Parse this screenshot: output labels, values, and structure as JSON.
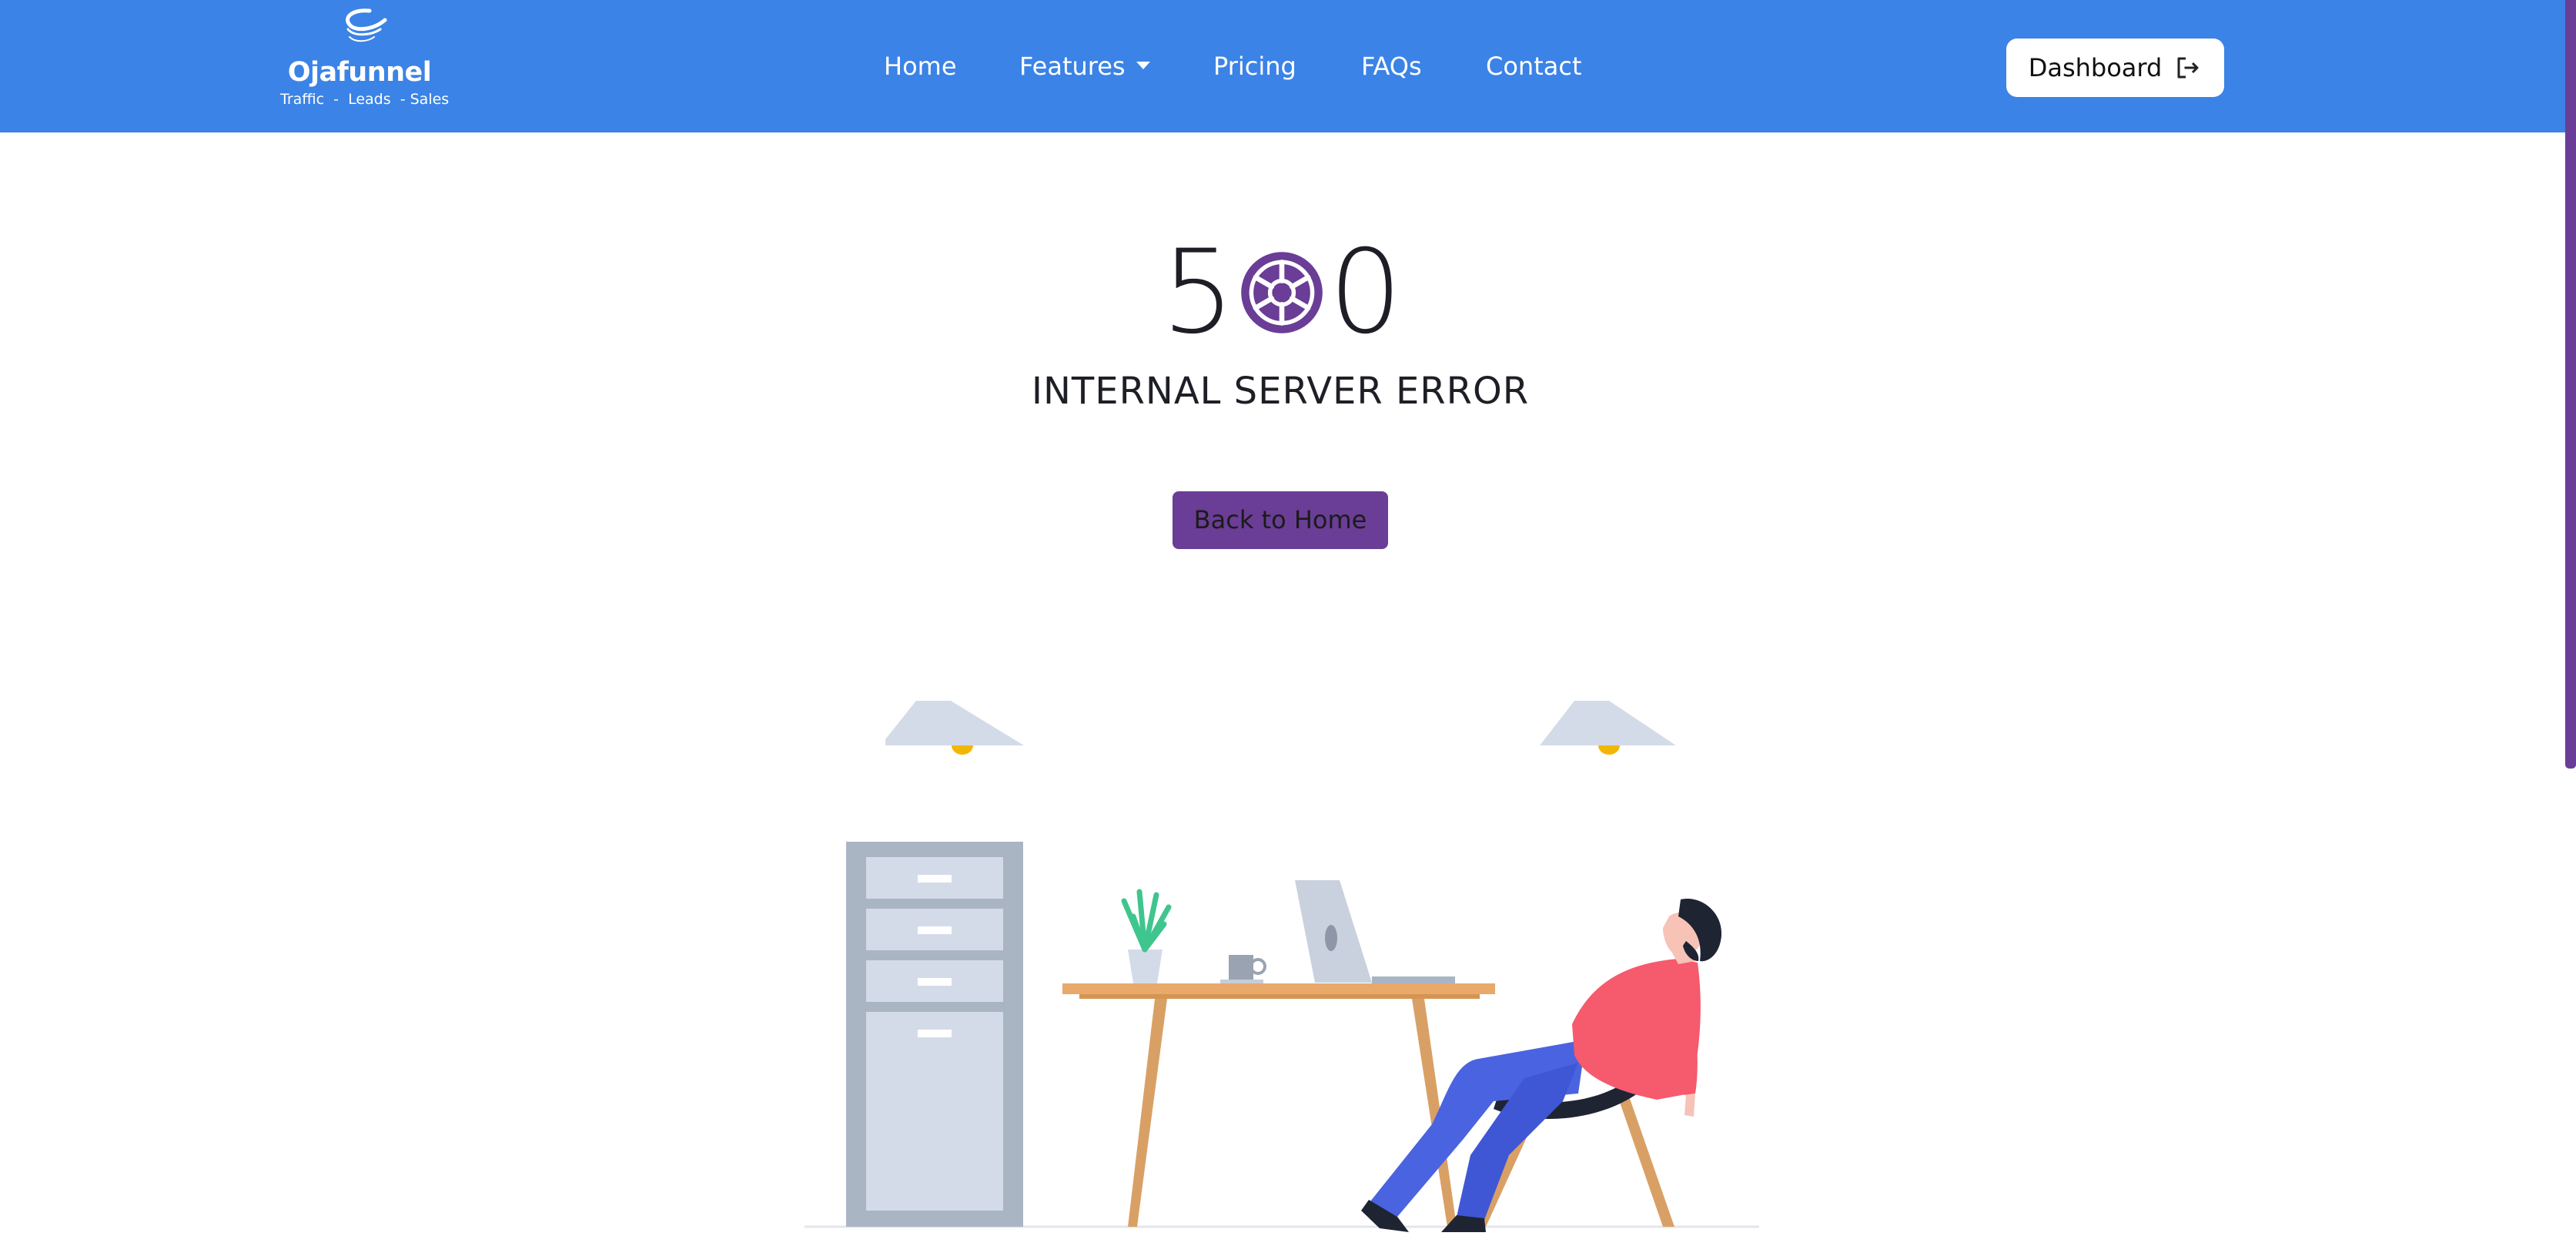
{
  "brand": {
    "name": "Ojafunnel",
    "tagline": "Traffic  -  Leads  - Sales"
  },
  "nav": {
    "items": [
      {
        "label": "Home"
      },
      {
        "label": "Features"
      },
      {
        "label": "Pricing"
      },
      {
        "label": "FAQs"
      },
      {
        "label": "Contact"
      }
    ],
    "dashboard_label": "Dashboard"
  },
  "error": {
    "code_first": "5",
    "code_last": "0",
    "title": "INTERNAL SERVER ERROR",
    "back_label": "Back to Home"
  },
  "icons": {
    "features_dropdown": "caret-down-icon",
    "dashboard": "logout-icon",
    "code_middle": "wheel-icon"
  },
  "colors": {
    "header": "#3b83e6",
    "accent": "#6a3d96",
    "text": "#1e1f26"
  }
}
